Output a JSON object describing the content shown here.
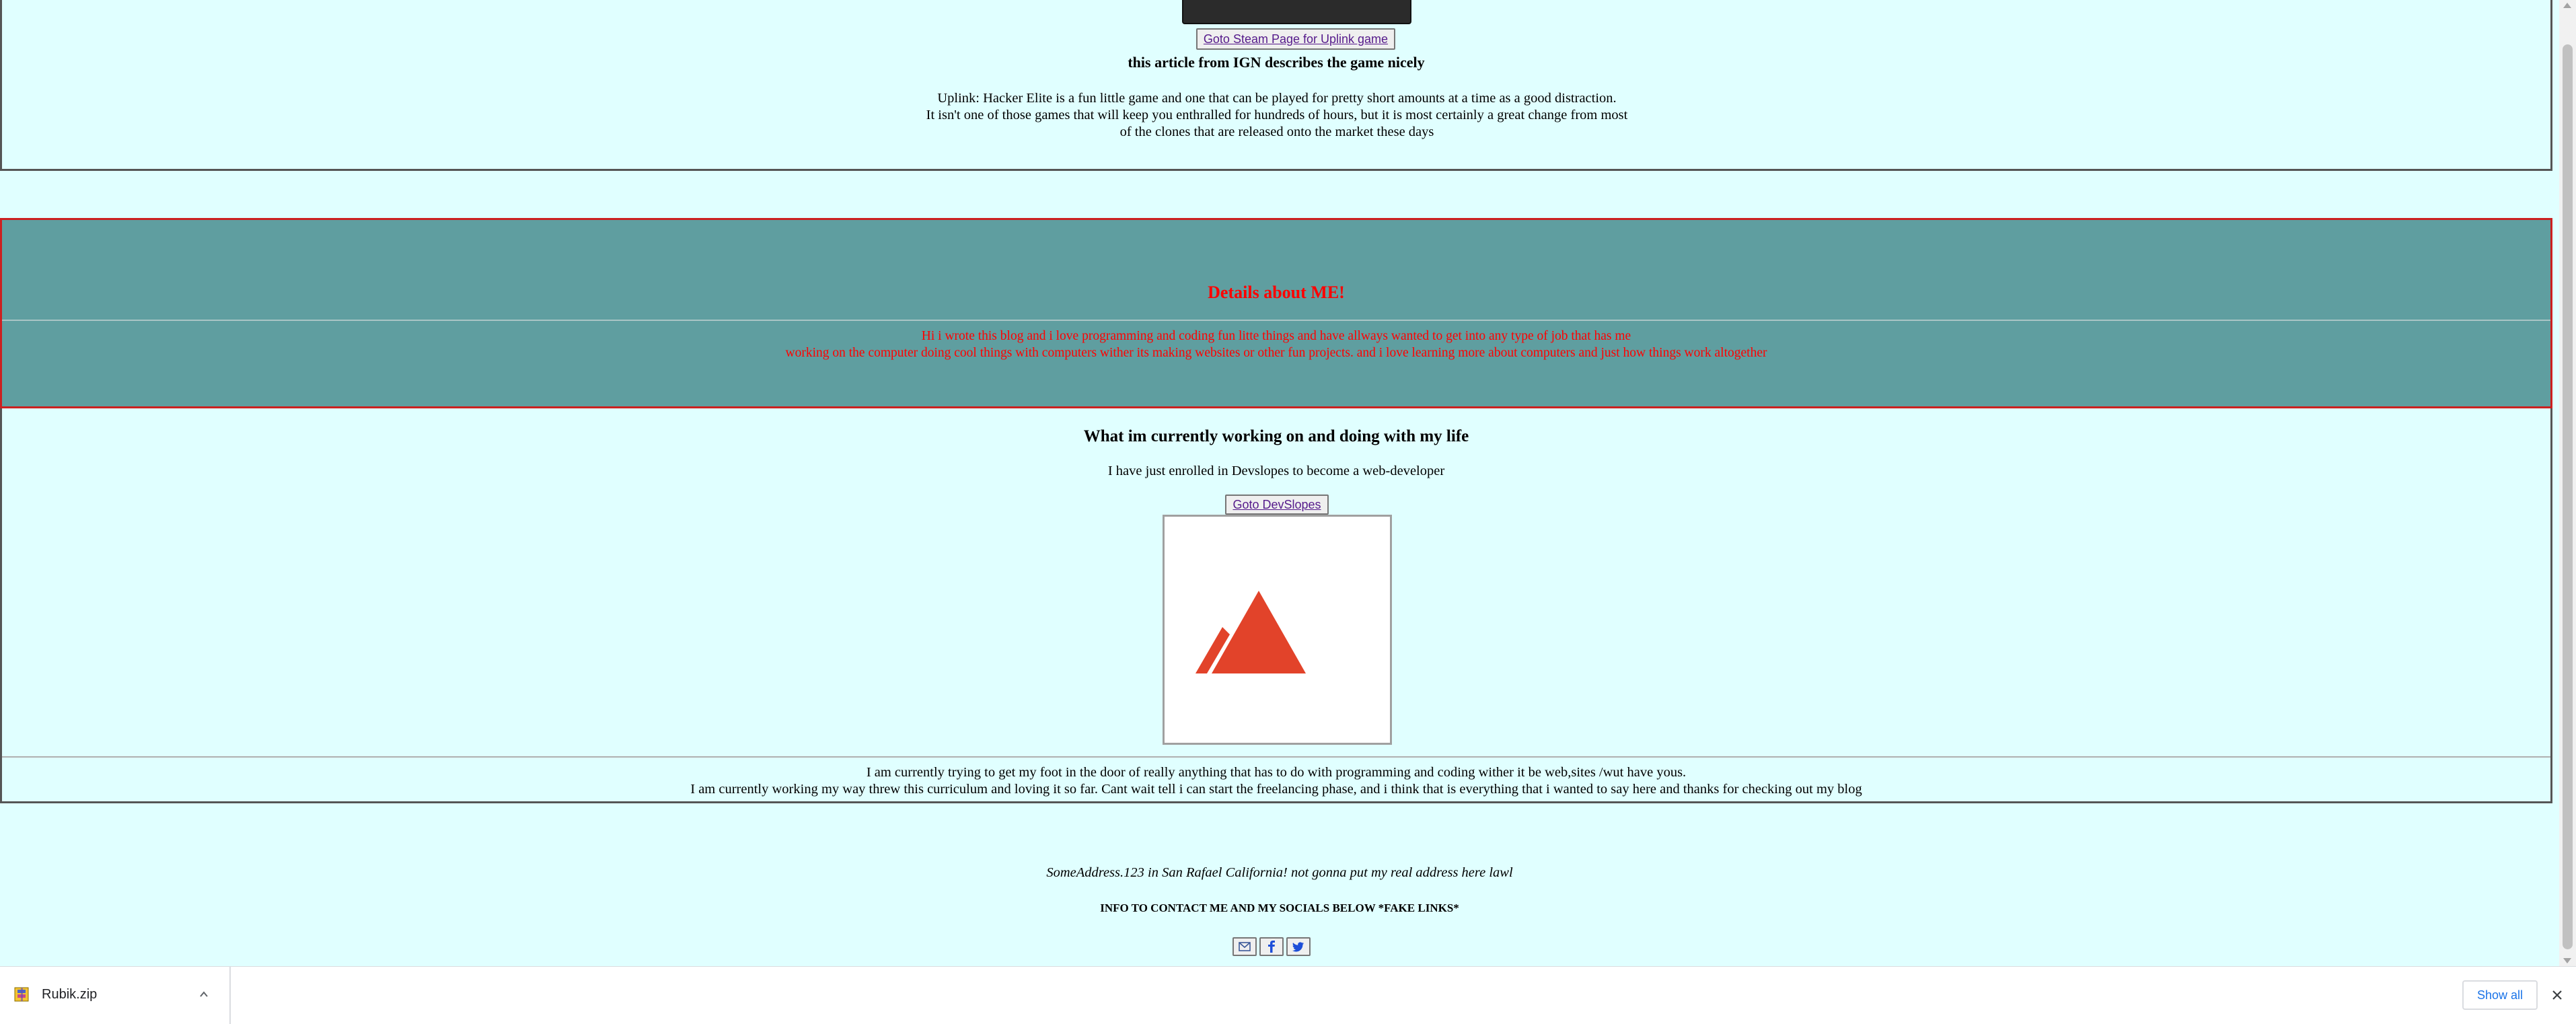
{
  "uplink": {
    "steam_button": "Goto Steam Page for Uplink game",
    "ign_title": "this article from IGN describes the game nicely",
    "ign_lines": [
      "Uplink: Hacker Elite is a fun little game and one that can be played for pretty short amounts at a time as a good distraction.",
      "It isn't one of those games that will keep you enthralled for hundreds of hours, but it is most certainly a great change from most",
      "of the clones that are released onto the market these days"
    ]
  },
  "details": {
    "title": "Details about ME!",
    "lines": [
      "Hi i wrote this blog and i love programming and coding fun litte things and have allways wanted to get into any type of job that has me",
      "working on the computer doing cool things with computers wither its making websites or other fun projects. and i love learning more about computers and just how things work altogether"
    ]
  },
  "work": {
    "title": "What im currently working on and doing with my life",
    "subtitle": "I have just enrolled in Devslopes to become a web-developer",
    "devslopes_button": "Goto DevSlopes",
    "lines": [
      "I am currently trying to get my foot in the door of really anything that has to do with programming and coding wither it be web,sites /wut have yous.",
      "I am currently working my way threw this curriculum and loving it so far. Cant wait tell i can start the freelancing phase, and i think that is everything that i wanted to say here and thanks for checking out my blog"
    ]
  },
  "footer": {
    "address": "SomeAddress.123 in San Rafael California! not gonna put my real address here lawl",
    "contact": "INFO TO CONTACT ME AND MY SOCIALS BELOW *FAKE LINKS*",
    "socials": [
      "email-icon",
      "facebook-icon",
      "twitter-icon"
    ]
  },
  "download_bar": {
    "file_name": "Rubik.zip",
    "show_all": "Show all"
  },
  "colors": {
    "page_bg": "#e0ffff",
    "details_bg": "#5f9ea0",
    "details_text": "#ff0000",
    "logo_red": "#e2432a",
    "link": "#551a8b"
  }
}
